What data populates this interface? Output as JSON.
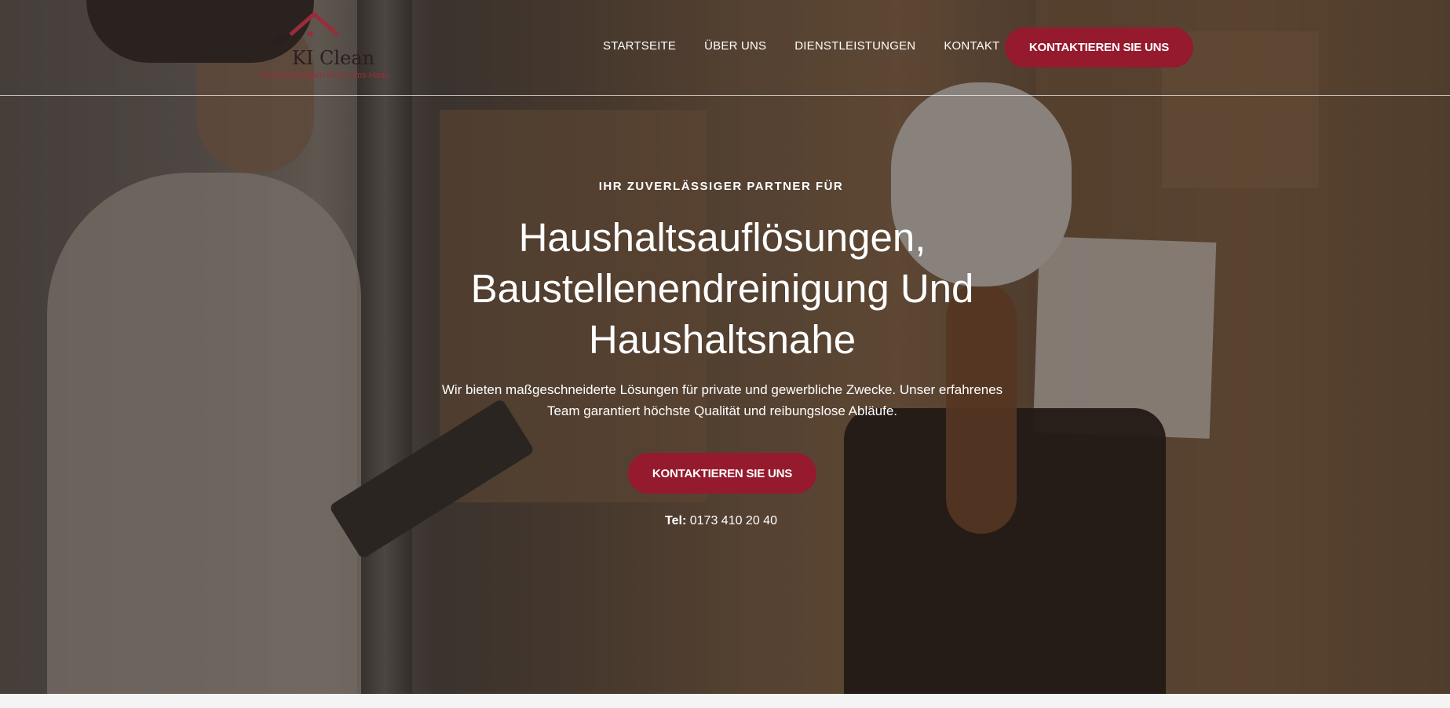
{
  "brand": {
    "name": "KI Clean",
    "tagline": "Dienstleistungen Rund ums Haus",
    "accent_color": "#951a2d"
  },
  "nav": {
    "items": [
      "STARTSEITE",
      "ÜBER UNS",
      "DIENSTLEISTUNGEN",
      "KONTAKT"
    ],
    "cta_label": "KONTAKTIEREN SIE UNS"
  },
  "hero": {
    "eyebrow": "IHR ZUVERLÄSSIGER PARTNER FÜR",
    "title_line1": "Haushaltsauflösungen,",
    "title_line2": "Baustellenendreinigung Und",
    "title_line3": "Haushaltsnahe",
    "lead_line1": "Wir bieten maßgeschneiderte Lösungen für private und gewerbliche Zwecke. Unser erfahrenes",
    "lead_line2": "Team garantiert höchste Qualität und reibungslose Abläufe.",
    "cta_label": "KONTAKTIEREN SIE UNS",
    "tel_label": "Tel:",
    "tel_number": "0173 410 20 40"
  }
}
